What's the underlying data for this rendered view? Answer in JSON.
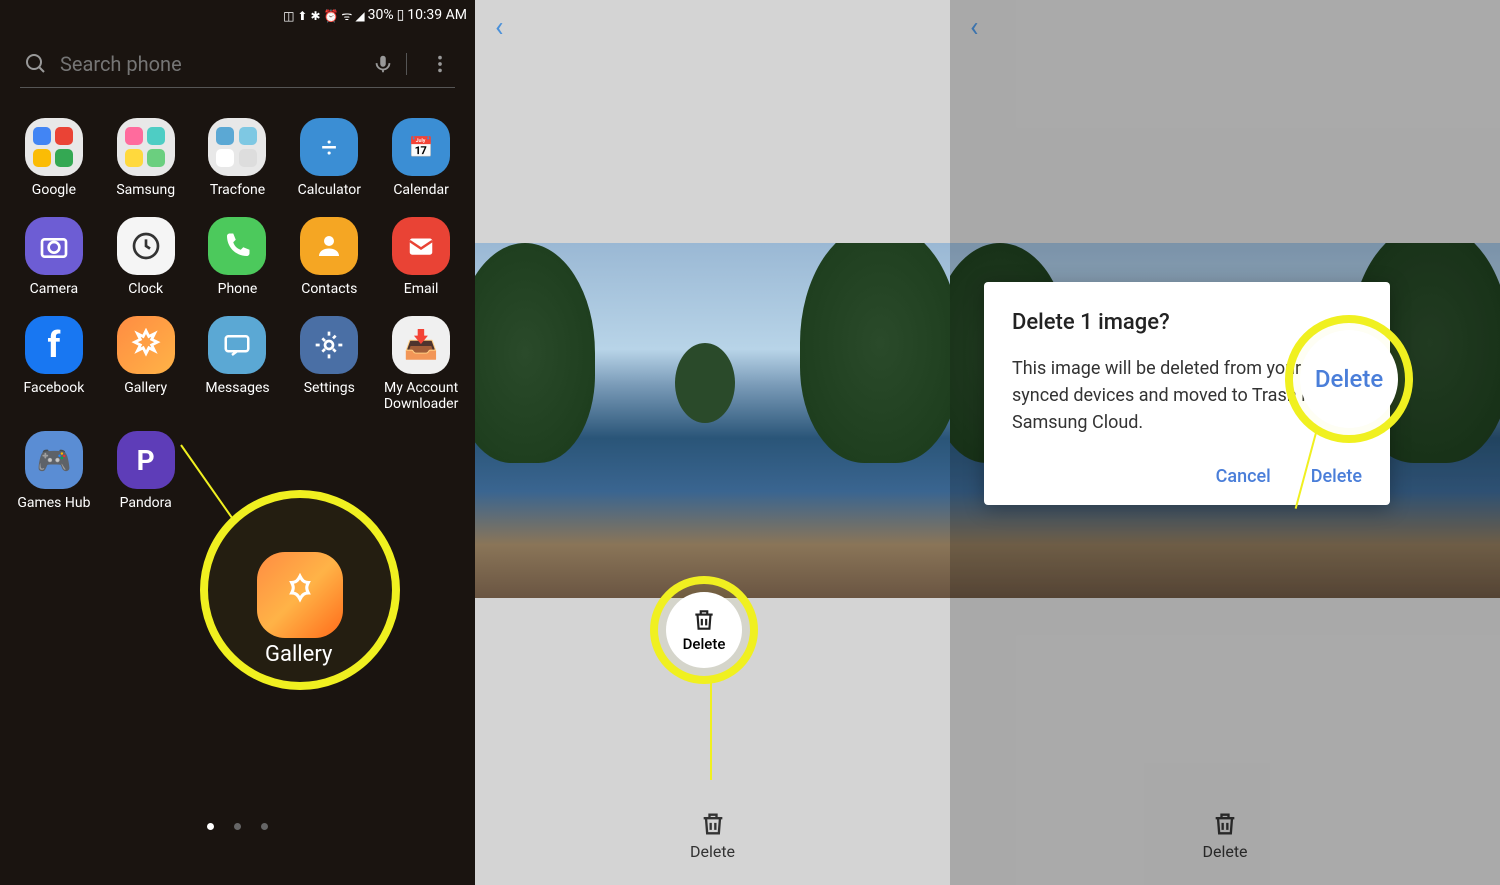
{
  "status": {
    "battery": "30%",
    "time": "10:39 AM"
  },
  "search": {
    "placeholder": "Search phone"
  },
  "apps": {
    "r1": [
      "Google",
      "Samsung",
      "Tracfone",
      "Calculator",
      "Calendar"
    ],
    "r2": [
      "Camera",
      "Clock",
      "Phone",
      "Contacts",
      "Email"
    ],
    "r3": [
      "Facebook",
      "Gallery",
      "Messages",
      "Settings",
      "My Account Downloader"
    ],
    "r4": [
      "Games Hub",
      "Pandora"
    ]
  },
  "highlight1": {
    "label": "Gallery"
  },
  "panel2": {
    "delete": "Delete",
    "bottom_delete": "Delete"
  },
  "panel3": {
    "delete": "Delete"
  },
  "dialog": {
    "title": "Delete 1 image?",
    "message": "This image will be deleted from your synced devices and moved to Trash in Samsung Cloud.",
    "cancel": "Cancel",
    "confirm": "Delete"
  },
  "callout_delete": "Delete"
}
